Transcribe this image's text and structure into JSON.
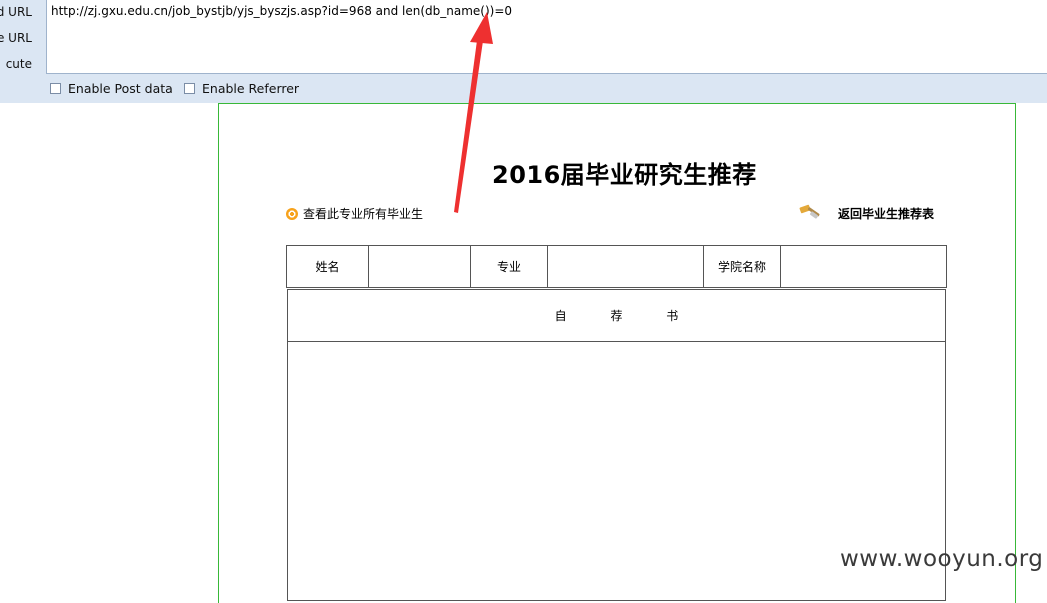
{
  "hackbar": {
    "labels": [
      "d URL",
      "e URL",
      "cute"
    ],
    "url_value": "http://zj.gxu.edu.cn/job_bystjb/yjs_byszjs.asp?id=968 and len(db_name())=0",
    "enable_post": "Enable Post data",
    "enable_referrer": "Enable Referrer"
  },
  "page": {
    "title": "2016届毕业研究生推荐",
    "view_all_link": "查看此专业所有毕业生",
    "back_link": "返回毕业生推荐表",
    "table": {
      "name_label": "姓名",
      "major_label": "专业",
      "college_label": "学院名称",
      "self_recommendation": "自 荐 书"
    }
  },
  "watermark": "www.wooyun.org",
  "colors": {
    "hackbar_bg": "#dbe6f3",
    "frame_border": "#38b838",
    "arrow": "#ee3030"
  }
}
